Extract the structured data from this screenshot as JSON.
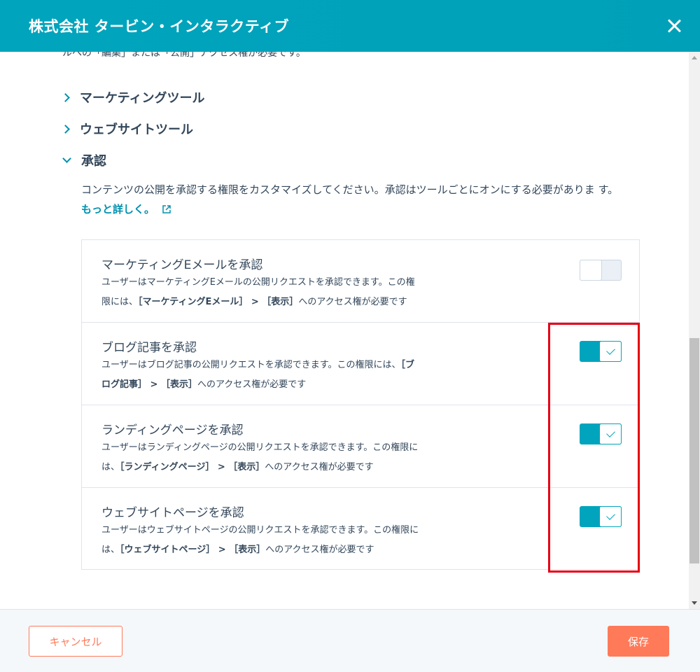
{
  "header": {
    "title": "株式会社 タービン・インタラクティブ"
  },
  "content": {
    "clipped_text": "ルへの「編集」または「公開」アクセス権が必要です。",
    "sections": [
      {
        "label": "マーケティングツール",
        "expanded": false
      },
      {
        "label": "ウェブサイトツール",
        "expanded": false
      },
      {
        "label": "承認",
        "expanded": true
      }
    ],
    "approval": {
      "description": "コンテンツの公開を承認する権限をカスタマイズしてください。承認はツールごとにオンにする必要がありま す。",
      "learn_more": "もっと詳しく。",
      "permissions": [
        {
          "title": "マーケティングEメールを承認",
          "desc_line1": "ユーザーはマーケティングEメールの公開リクエストを承認できます。この権",
          "desc_line2_prefix": "限には、",
          "desc_line2_bold": "［マーケティングEメール］ > ［表示］",
          "desc_line2_suffix": "へのアクセス権が必要です",
          "enabled": false
        },
        {
          "title": "ブログ記事を承認",
          "desc_line1_prefix": "ユーザーはブログ記事の公開リクエストを承認できます。この権限には、",
          "desc_line1_bold": "［ブ",
          "desc_line2_bold": "ログ記事］ > ［表示］",
          "desc_line2_suffix": "へのアクセス権が必要です",
          "enabled": true
        },
        {
          "title": "ランディングページを承認",
          "desc_line1": "ユーザーはランディングページの公開リクエストを承認できます。この権限に",
          "desc_line2_prefix": "は、",
          "desc_line2_bold": "［ランディングページ］ > ［表示］",
          "desc_line2_suffix": "へのアクセス権が必要です",
          "enabled": true
        },
        {
          "title": "ウェブサイトページを承認",
          "desc_line1": "ユーザーはウェブサイトページの公開リクエストを承認できます。この権限に",
          "desc_line2_prefix": "は、",
          "desc_line2_bold": "［ウェブサイトページ］ > ［表示］",
          "desc_line2_suffix": "へのアクセス権が必要です",
          "enabled": true
        }
      ]
    }
  },
  "footer": {
    "cancel_label": "キャンセル",
    "save_label": "保存"
  },
  "colors": {
    "header": "#00a4bd",
    "accent": "#0091ae",
    "toggle_on": "#00a4bd",
    "button": "#ff7a59",
    "highlight": "#e60012"
  },
  "icons": [
    "close-icon",
    "chevron-right-icon",
    "chevron-down-icon",
    "external-link-icon",
    "check-icon"
  ]
}
